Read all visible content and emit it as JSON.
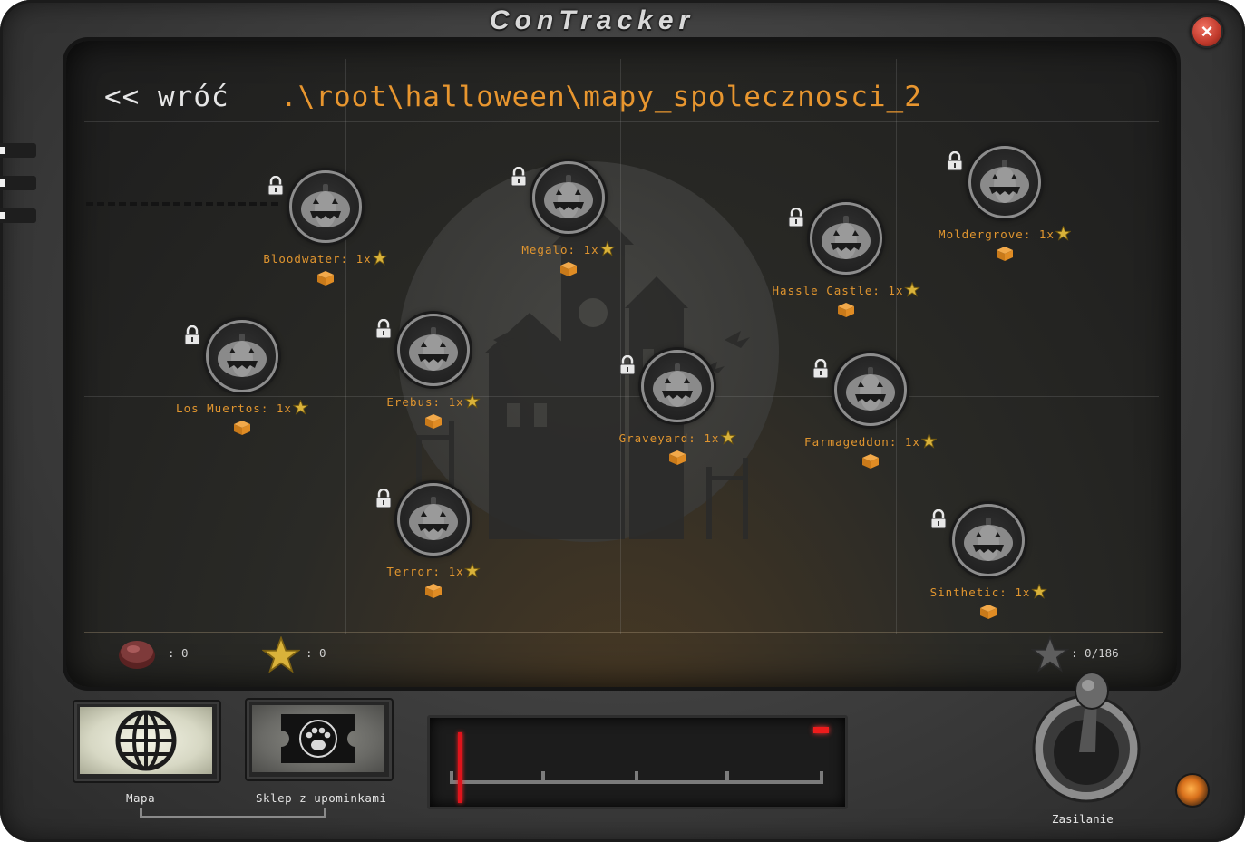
{
  "app": {
    "title": "ConTracker",
    "close_icon": "close-icon"
  },
  "nav": {
    "back_label": "<< wróć",
    "path": ".\\root\\halloween\\mapy_spolecznosci_2"
  },
  "maps": [
    {
      "id": "bloodwater",
      "label": "Bloodwater: 1x",
      "locked": true
    },
    {
      "id": "megalo",
      "label": "Megalo: 1x",
      "locked": true
    },
    {
      "id": "hassle-castle",
      "label": "Hassle Castle: 1x",
      "locked": true
    },
    {
      "id": "moldergrove",
      "label": "Moldergrove: 1x",
      "locked": true
    },
    {
      "id": "los-muertos",
      "label": "Los Muertos: 1x",
      "locked": true
    },
    {
      "id": "erebus",
      "label": "Erebus: 1x",
      "locked": true
    },
    {
      "id": "graveyard",
      "label": "Graveyard: 1x",
      "locked": true
    },
    {
      "id": "farmageddon",
      "label": "Farmageddon: 1x",
      "locked": true
    },
    {
      "id": "terror",
      "label": "Terror: 1x",
      "locked": true
    },
    {
      "id": "sinthetic",
      "label": "Sinthetic: 1x",
      "locked": true
    }
  ],
  "stats": {
    "candy": ": 0",
    "stars": ": 0",
    "total": ": 0/186"
  },
  "buttons": {
    "map_label": "Mapa",
    "shop_label": "Sklep z upominkami",
    "power_label": "Zasilanie"
  },
  "colors": {
    "accent_orange": "#e8962f",
    "close_red": "#c0392b",
    "indicator_red": "#ee1c1c"
  }
}
